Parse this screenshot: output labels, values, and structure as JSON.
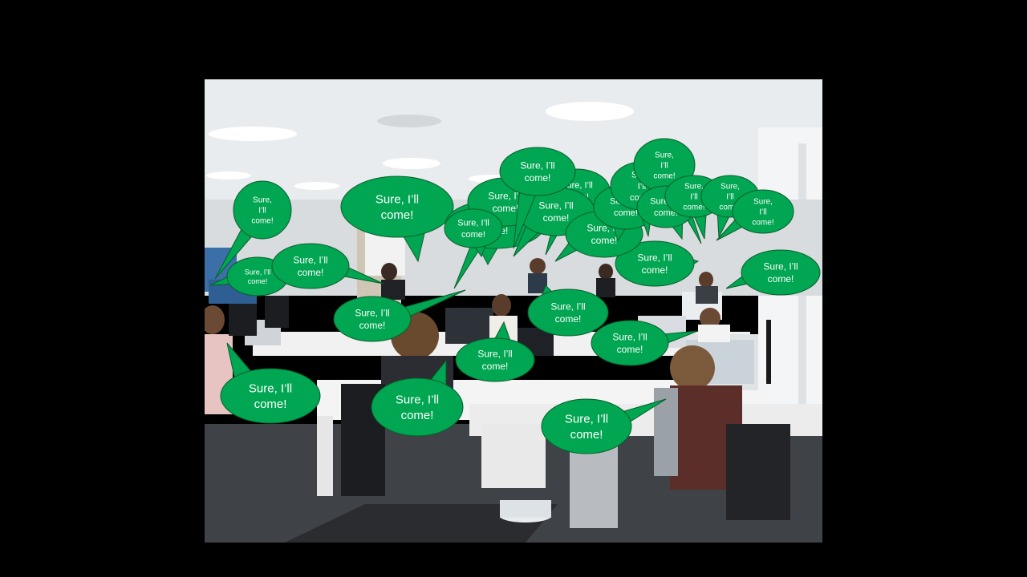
{
  "slide": {
    "background": "#000000",
    "photo_description_icon": "office-photo"
  },
  "bubble_style": {
    "fill": "#00A651",
    "stroke": "#0b5d2b",
    "text_color": "#ffffff"
  },
  "bubbles": [
    {
      "text": "Sure, I’ll come!"
    },
    {
      "text": "Sure, I’ll come!"
    },
    {
      "text": "Sure, I’ll come!"
    },
    {
      "text": "Sure, I’ll come!"
    },
    {
      "text": "Sure, I’ll come!"
    },
    {
      "text": "Sure, I’ll come!"
    },
    {
      "text": "Sure, I’ll come!"
    },
    {
      "text": "Sure, I’ll come!"
    },
    {
      "text": "Sure, I’ll come!"
    },
    {
      "text": "Sure, I’ll come!"
    },
    {
      "text": "Sure, I’ll come!"
    },
    {
      "text": "Sure, I’ll come!"
    },
    {
      "text": "Sure, I’ll come!"
    },
    {
      "text": "Sure, I’ll come!"
    },
    {
      "text": "Sure, I’ll come!"
    },
    {
      "text": "Sure, I’ll come!"
    },
    {
      "text": "Sure, I’ll come!"
    },
    {
      "text": "Sure, I’ll come!"
    },
    {
      "text": "Sure, I’ll come!"
    },
    {
      "text": "Sure, I’ll come!"
    },
    {
      "text": "Sure, I’ll come!"
    },
    {
      "text": "Sure, I’ll come!"
    },
    {
      "text": "Sure, I’ll come!"
    },
    {
      "text": "Sure, I’ll come!"
    },
    {
      "text": "Sure, I’ll come!"
    },
    {
      "text": "Sure, I’ll come!"
    },
    {
      "text": "Sure, I’ll come!"
    }
  ]
}
